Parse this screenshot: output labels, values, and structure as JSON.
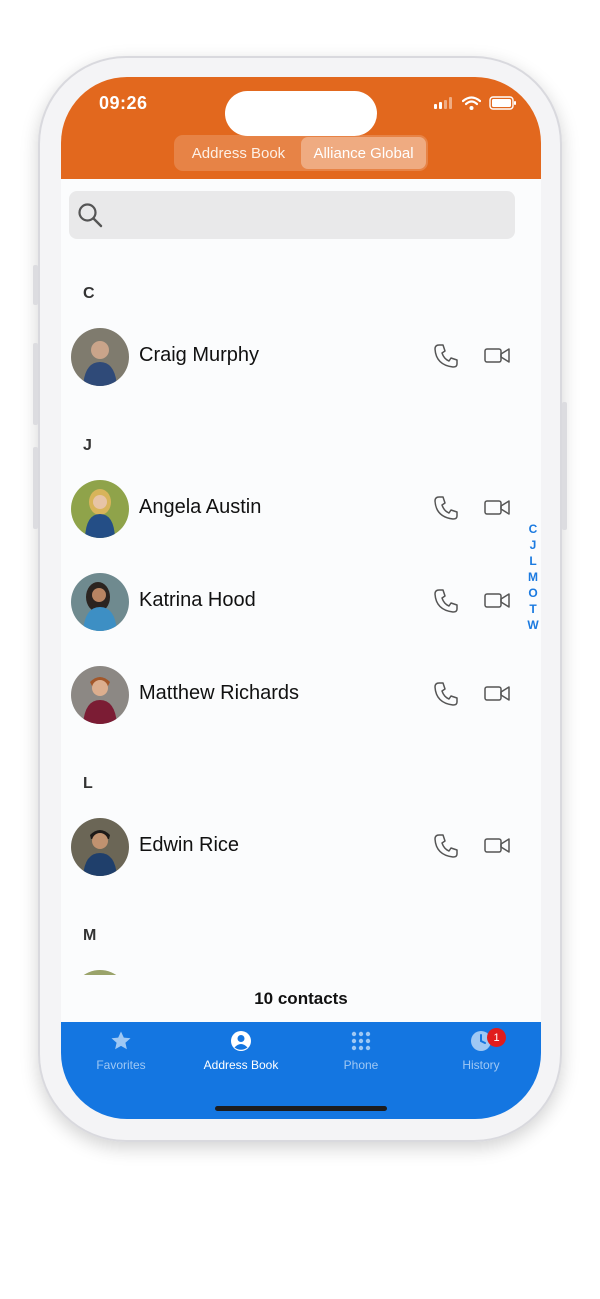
{
  "status_bar": {
    "time": "09:26"
  },
  "header": {
    "segments": [
      "Address Book",
      "Alliance Global"
    ],
    "active_segment": 1
  },
  "search": {
    "placeholder": ""
  },
  "sections": [
    {
      "letter": "C",
      "contacts": [
        {
          "name": "Craig Murphy"
        }
      ]
    },
    {
      "letter": "J",
      "contacts": [
        {
          "name": "Angela Austin"
        },
        {
          "name": "Katrina Hood"
        },
        {
          "name": "Matthew Richards"
        }
      ]
    },
    {
      "letter": "L",
      "contacts": [
        {
          "name": "Edwin Rice"
        }
      ]
    },
    {
      "letter": "M",
      "contacts": []
    }
  ],
  "index_letters": [
    "C",
    "J",
    "L",
    "M",
    "O",
    "T",
    "W"
  ],
  "contacts_count": "10 contacts",
  "tabbar": {
    "tabs": [
      {
        "label": "Favorites",
        "icon": "star-icon"
      },
      {
        "label": "Address Book",
        "icon": "person-circle-icon"
      },
      {
        "label": "Phone",
        "icon": "keypad-icon"
      },
      {
        "label": "History",
        "icon": "clock-icon",
        "badge": "1"
      }
    ],
    "active_tab": 1
  },
  "colors": {
    "header": "#e2681e",
    "tabbar": "#1476e1",
    "index": "#1b7ae0",
    "badge": "#e11c1c"
  }
}
